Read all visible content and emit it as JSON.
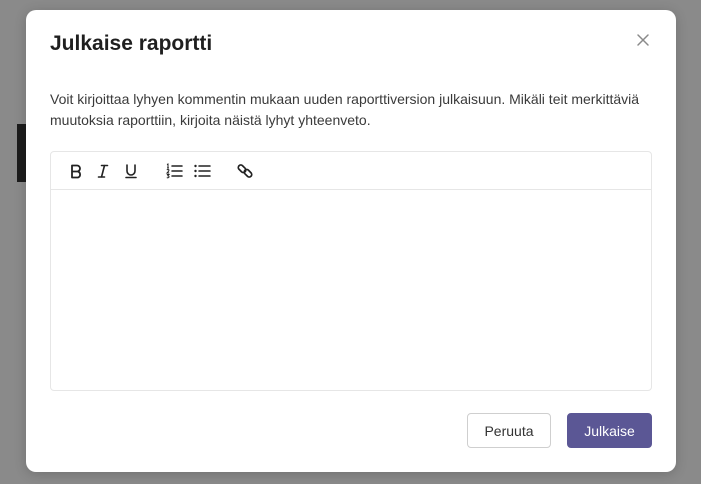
{
  "modal": {
    "title": "Julkaise raportti",
    "close_icon": "close-icon",
    "description": "Voit kirjoittaa lyhyen kommentin mukaan uuden raporttiversion julkaisuun. Mikäli teit merkittäviä muutoksia raporttiin, kirjoita näistä lyhyt yhteenveto."
  },
  "editor": {
    "toolbar": [
      {
        "name": "bold",
        "icon": "bold-icon"
      },
      {
        "name": "italic",
        "icon": "italic-icon"
      },
      {
        "name": "underline",
        "icon": "underline-icon"
      },
      {
        "name": "ordered-list",
        "icon": "ordered-list-icon"
      },
      {
        "name": "bullet-list",
        "icon": "bullet-list-icon"
      },
      {
        "name": "link",
        "icon": "link-icon"
      }
    ],
    "content": ""
  },
  "actions": {
    "cancel_label": "Peruuta",
    "publish_label": "Julkaise"
  },
  "colors": {
    "primary": "#5b5795",
    "backdrop": "#8a8a8a",
    "border": "#e6e6e6"
  }
}
